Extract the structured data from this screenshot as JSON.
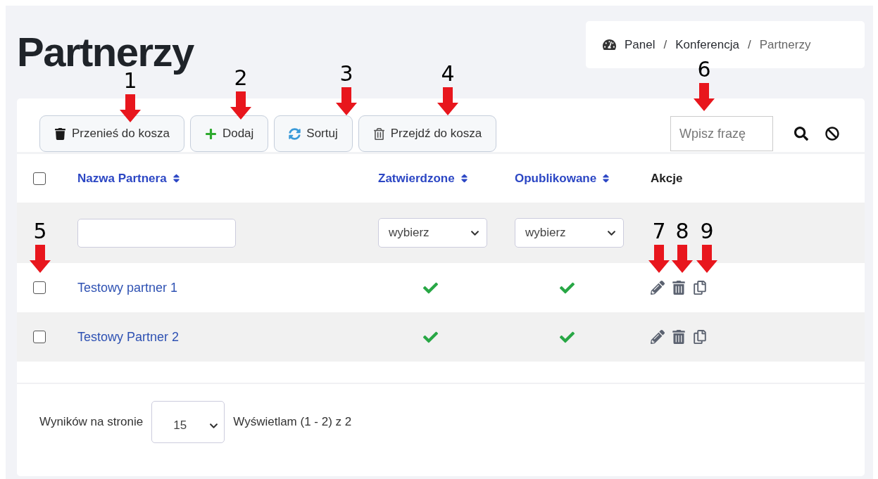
{
  "page_title": "Partnerzy",
  "breadcrumb": [
    {
      "label": "Panel"
    },
    {
      "separator": "/",
      "label": "Konferencja"
    },
    {
      "separator": "/",
      "label": "Partnerzy"
    }
  ],
  "toolbar": {
    "buttons": [
      {
        "label": "Przenieś do kosza",
        "kind": "trash"
      },
      {
        "label": "Dodaj",
        "kind": "add"
      },
      {
        "label": "Sortuj",
        "kind": "sort"
      },
      {
        "label": "Przejdź do kosza",
        "kind": "bin"
      }
    ],
    "search": {
      "placeholder": "Wpisz frazę"
    }
  },
  "table": {
    "select_all": {
      "checked": false
    },
    "columns": [
      {
        "label": "Nazwa Partnera",
        "sortable": true
      },
      {
        "label": "Zatwierdzone",
        "sortable": true
      },
      {
        "label": "Opublikowane",
        "sortable": true
      },
      {
        "label": "Akcje",
        "sortable": false
      }
    ],
    "filters": {
      "approved": "wybierz",
      "published": "wybierz"
    },
    "rows": [
      {
        "checked": false,
        "name": "Testowy partner 1",
        "approved": true,
        "published": true
      },
      {
        "checked": false,
        "name": "Testowy Partner 2",
        "approved": true,
        "published": true
      }
    ]
  },
  "pagination": {
    "label": "Wyników na stronie",
    "per_page": "15",
    "summary": "Wyświetlam (1 - 2) z 2"
  },
  "annotations": [
    {
      "label": "1"
    },
    {
      "label": "2"
    },
    {
      "label": "3"
    },
    {
      "label": "4"
    },
    {
      "label": "6"
    },
    {
      "label": "5"
    },
    {
      "label": "7"
    },
    {
      "label": "8"
    },
    {
      "label": "9"
    }
  ]
}
